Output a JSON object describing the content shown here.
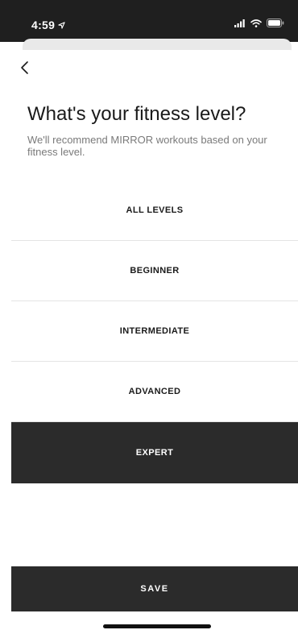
{
  "status_bar": {
    "time": "4:59",
    "location_icon": "location-arrow-icon",
    "signal_icon": "cellular-signal-icon",
    "wifi_icon": "wifi-icon",
    "battery_icon": "battery-icon"
  },
  "header": {
    "back_icon": "chevron-left-icon",
    "title": "What's your fitness level?",
    "subtitle": "We'll recommend MIRROR workouts based on your fitness level."
  },
  "levels": [
    {
      "label": "ALL LEVELS",
      "selected": false
    },
    {
      "label": "BEGINNER",
      "selected": false
    },
    {
      "label": "INTERMEDIATE",
      "selected": false
    },
    {
      "label": "ADVANCED",
      "selected": false
    },
    {
      "label": "EXPERT",
      "selected": true
    }
  ],
  "footer": {
    "save_label": "SAVE"
  },
  "colors": {
    "status_bar_bg": "#1f1f1f",
    "selected_bg": "#2b2b2b",
    "selected_text": "#ffffff",
    "text_primary": "#1a1a1a",
    "text_secondary": "#7a7a7a",
    "divider": "#e4e4e4"
  }
}
